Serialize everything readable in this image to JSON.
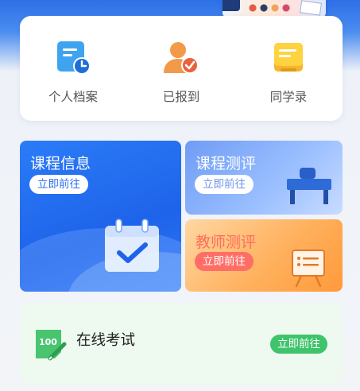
{
  "quick_links": [
    {
      "label": "个人档案",
      "icon": "profile-icon"
    },
    {
      "label": "已报到",
      "icon": "checked-in-icon"
    },
    {
      "label": "同学录",
      "icon": "classmates-icon"
    }
  ],
  "tiles": {
    "course_info": {
      "title": "课程信息",
      "button": "立即前往",
      "icon": "calendar-check-icon"
    },
    "course_eval": {
      "title": "课程测评",
      "button": "立即前往",
      "icon": "desk-icon"
    },
    "teacher_eval": {
      "title": "教师测评",
      "button": "立即前往",
      "icon": "presentation-board-icon"
    }
  },
  "exam": {
    "title": "在线考试",
    "button": "立即前往",
    "icon": "score-100-icon"
  },
  "colors": {
    "primary": "#1e63ea",
    "orange": "#ff9a3a",
    "green": "#3fc36b",
    "coral": "#ff6e66"
  }
}
